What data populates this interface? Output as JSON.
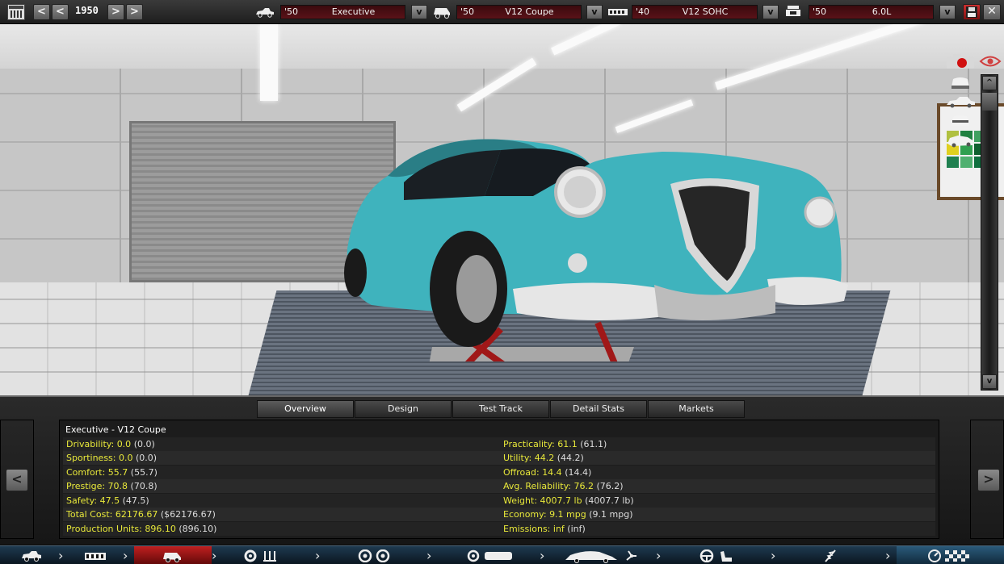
{
  "topbar": {
    "year": "1950",
    "car_model": {
      "year": "'50",
      "name": "Executive"
    },
    "trim": {
      "year": "'50",
      "name": "V12 Coupe"
    },
    "engine_family": {
      "year": "'40",
      "name": "V12 SOHC"
    },
    "engine_variant": {
      "year": "'50",
      "name": "6.0L"
    },
    "prev_label": "<",
    "next_label": ">",
    "v_label": "v"
  },
  "scrollbar": {
    "up": "^",
    "down": "v"
  },
  "tabs": [
    "Overview",
    "Design",
    "Test Track",
    "Detail Stats",
    "Markets"
  ],
  "active_tab": "Overview",
  "nav": {
    "prev": "<",
    "next": ">"
  },
  "overview": {
    "title": "Executive - V12 Coupe",
    "left_stats": [
      {
        "label": "Drivability:",
        "value": "0.0",
        "paren": "(0.0)"
      },
      {
        "label": "Sportiness:",
        "value": "0.0",
        "paren": "(0.0)"
      },
      {
        "label": "Comfort:",
        "value": "55.7",
        "paren": "(55.7)"
      },
      {
        "label": "Prestige:",
        "value": "70.8",
        "paren": "(70.8)"
      },
      {
        "label": "Safety:",
        "value": "47.5",
        "paren": "(47.5)"
      },
      {
        "label": "Total Cost:",
        "value": "62176.67",
        "paren": "($62176.67)"
      },
      {
        "label": "Production Units:",
        "value": "896.10",
        "paren": "(896.10)"
      }
    ],
    "right_stats": [
      {
        "label": "Practicality:",
        "value": "61.1",
        "paren": "(61.1)"
      },
      {
        "label": "Utility:",
        "value": "44.2",
        "paren": "(44.2)"
      },
      {
        "label": "Offroad:",
        "value": "14.4",
        "paren": "(14.4)"
      },
      {
        "label": "Avg. Reliability:",
        "value": "76.2",
        "paren": "(76.2)"
      },
      {
        "label": "Weight:",
        "value": "4007.7 lb",
        "paren": "(4007.7 lb)"
      },
      {
        "label": "Economy:",
        "value": "9.1 mpg",
        "paren": "(9.1 mpg)"
      },
      {
        "label": "Emissions:",
        "value": "inf",
        "paren": "(inf)"
      }
    ]
  },
  "colors": {
    "accent_red": "#c02020",
    "stat_yellow": "#e8e83a",
    "field_bg": "#4a0e14",
    "car_body": "#3fb3bd"
  },
  "icons": {
    "calendar": "calendar-icon",
    "save": "save-icon",
    "close": "close-icon",
    "record": "record-camera-icon",
    "eye": "eye-icon"
  }
}
